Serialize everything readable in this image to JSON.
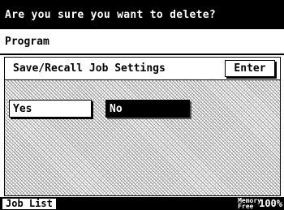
{
  "dialog": {
    "title": "Are you sure you want to delete?",
    "program_label": "Program"
  },
  "panel": {
    "title": "Save/Recall Job Settings",
    "enter_label": "Enter"
  },
  "choices": {
    "yes_label": "Yes",
    "no_label": "No",
    "selected": "No"
  },
  "status_bar": {
    "job_list_label": "Job List",
    "memory_label": "Memory Free",
    "memory_value": "100%"
  },
  "colors": {
    "background": "#ffffff",
    "foreground": "#000000",
    "hatch": "#9a9a9a"
  }
}
